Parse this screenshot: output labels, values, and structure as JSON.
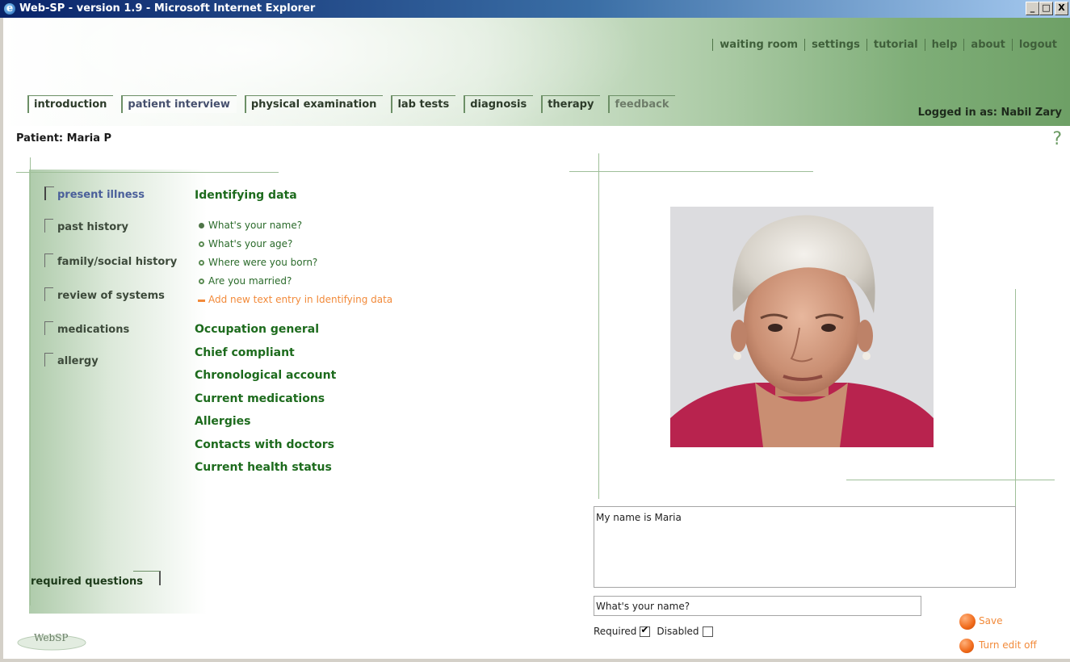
{
  "window": {
    "title": "Web-SP - version 1.9 - Microsoft Internet Explorer",
    "controls": {
      "minimize": "_",
      "maximize": "□",
      "close": "X"
    }
  },
  "topnav": [
    "waiting room",
    "settings",
    "tutorial",
    "help",
    "about",
    "logout"
  ],
  "tabs": [
    {
      "label": "introduction"
    },
    {
      "label": "patient interview"
    },
    {
      "label": "physical examination"
    },
    {
      "label": "lab tests"
    },
    {
      "label": "diagnosis"
    },
    {
      "label": "therapy"
    },
    {
      "label": "feedback"
    }
  ],
  "active_tab": "patient interview",
  "logged_in": "Logged in as: Nabil Zary",
  "patient": "Patient: Maria P",
  "help_symbol": "?",
  "sidebar": {
    "items": [
      "present illness",
      "past history",
      "family/social history",
      "review of systems",
      "medications",
      "allergy"
    ],
    "active": "present illness",
    "required_questions": "required questions"
  },
  "content": {
    "section": "Identifying data",
    "questions": [
      {
        "text": "What's your name?",
        "selected": true
      },
      {
        "text": "What's your age?",
        "selected": false
      },
      {
        "text": "Where were you born?",
        "selected": false
      },
      {
        "text": "Are you married?",
        "selected": false
      }
    ],
    "add_entry": "Add new text entry in Identifying data",
    "other_sections": [
      "Occupation general",
      "Chief compliant",
      "Chronological account",
      "Current medications",
      "Allergies",
      "Contacts with doctors",
      "Current health status"
    ]
  },
  "editor": {
    "answer": "My name is Maria",
    "question": "What's your name?",
    "required_label": "Required",
    "required_checked": true,
    "disabled_label": "Disabled",
    "disabled_checked": false,
    "save_label": "Save",
    "turn_edit_off_label": "Turn edit off"
  },
  "logo_text": "WebSP",
  "colors": {
    "title_bar": "#0a246a",
    "header_green": "#6ea066",
    "section_green": "#1d6b1d",
    "accent_orange": "#f28a3a"
  }
}
